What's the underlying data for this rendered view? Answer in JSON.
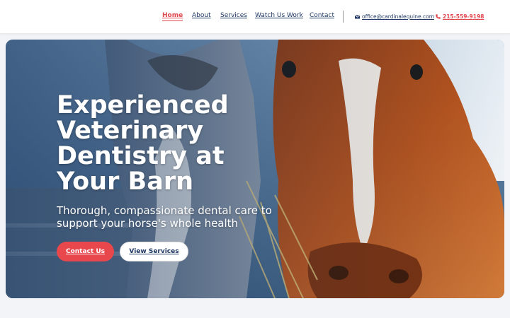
{
  "nav": {
    "items": [
      {
        "label": "Home",
        "active": true
      },
      {
        "label": "About",
        "active": false
      },
      {
        "label": "Services",
        "active": false
      },
      {
        "label": "Watch Us Work",
        "active": false
      },
      {
        "label": "Contact",
        "active": false
      }
    ]
  },
  "contact": {
    "email": "office@cardinalequine.com",
    "phone": "215-559-9198",
    "email_icon": "envelope-icon",
    "phone_icon": "phone-icon"
  },
  "hero": {
    "title": "Experienced Veterinary Dentistry at Your Barn",
    "subtitle": "Thorough, compassionate dental care to support your horse's whole health",
    "primary_button": "Contact Us",
    "secondary_button": "View Services"
  },
  "colors": {
    "accent": "#e8474c",
    "navy": "#1f3763"
  }
}
